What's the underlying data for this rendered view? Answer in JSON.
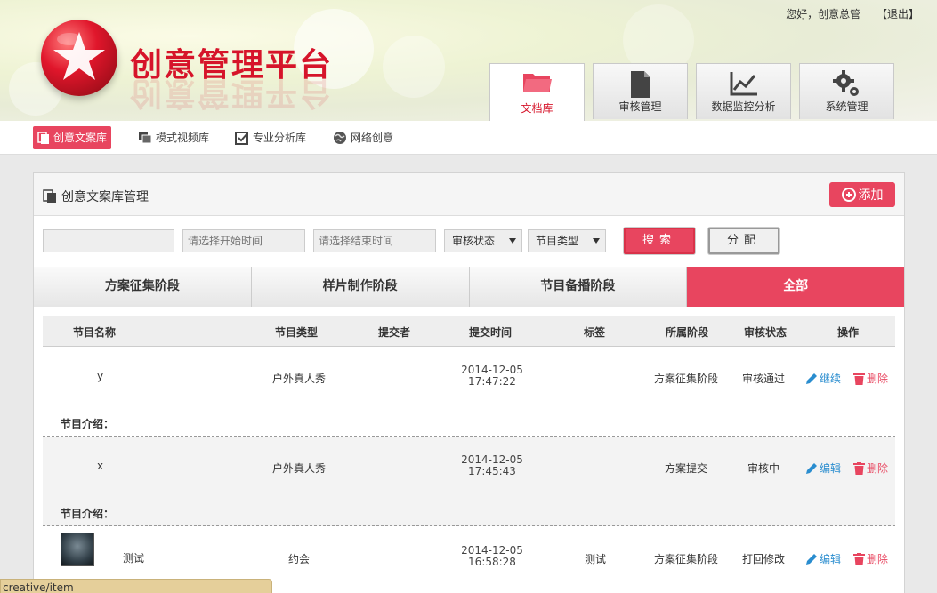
{
  "header": {
    "title": "创意管理平台",
    "user_greeting": "您好，创意总管",
    "logout": "【退出】"
  },
  "main_tabs": [
    {
      "label": "文档库",
      "icon": "folder-icon",
      "active": true
    },
    {
      "label": "审核管理",
      "icon": "document-icon",
      "active": false
    },
    {
      "label": "数据监控分析",
      "icon": "line-chart-icon",
      "active": false
    },
    {
      "label": "系统管理",
      "icon": "gears-icon",
      "active": false
    }
  ],
  "subnav": [
    {
      "label": "创意文案库",
      "icon": "copy-icon",
      "active": true
    },
    {
      "label": "模式视频库",
      "icon": "stack-icon",
      "active": false
    },
    {
      "label": "专业分析库",
      "icon": "checkbox-icon",
      "active": false
    },
    {
      "label": "网络创意",
      "icon": "globe-icon",
      "active": false
    }
  ],
  "panel": {
    "title": "创意文案库管理",
    "add_label": "添加"
  },
  "filter": {
    "keyword_value": "",
    "start_placeholder": "请选择开始时间",
    "end_placeholder": "请选择结束时间",
    "status_label": "审核状态",
    "type_label": "节目类型",
    "search_label": "搜索",
    "assign_label": "分配"
  },
  "stage_tabs": [
    {
      "label": "方案征集阶段",
      "active": false
    },
    {
      "label": "样片制作阶段",
      "active": false
    },
    {
      "label": "节目备播阶段",
      "active": false
    },
    {
      "label": "全部",
      "active": true
    }
  ],
  "table": {
    "headers": [
      "节目名称",
      "节目类型",
      "提交者",
      "提交时间",
      "标签",
      "所属阶段",
      "审核状态",
      "操作"
    ],
    "intro_label": "节目介绍：",
    "rows": [
      {
        "name": "y",
        "type": "户外真人秀",
        "submitter": "",
        "date": "2014-12-05",
        "time": "17:47:22",
        "tag": "",
        "stage": "方案征集阶段",
        "status": "审核通过",
        "action": "继续",
        "delete": "删除"
      },
      {
        "name": "x",
        "type": "户外真人秀",
        "submitter": "",
        "date": "2014-12-05",
        "time": "17:45:43",
        "tag": "",
        "stage": "方案提交",
        "status": "审核中",
        "action": "编辑",
        "delete": "删除"
      },
      {
        "name": "测试",
        "type": "约会",
        "submitter": "",
        "date": "2014-12-05",
        "time": "16:58:28",
        "tag": "测试",
        "stage": "方案征集阶段",
        "status": "打回修改",
        "action": "编辑",
        "delete": "删除"
      }
    ]
  },
  "status_bar": "creative/item",
  "colors": {
    "accent": "#e8455f",
    "brand": "#d6142a",
    "link": "#2a8dcf"
  }
}
